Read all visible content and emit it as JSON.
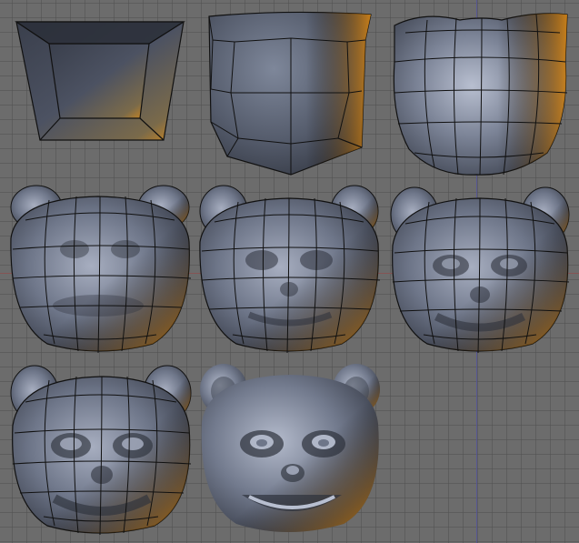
{
  "viewport": {
    "grid_color": "#505050",
    "background_color": "#6c6c6c",
    "axis_x_color": "#8a5050",
    "axis_y_color": "#55559a"
  },
  "material": {
    "base_color": "#8a93a8",
    "shadow_color": "#30343f",
    "highlight_color": "#c9cfdd",
    "rim_light_color": "#d48a1c",
    "wire_color": "#111111"
  },
  "stages": [
    {
      "id": "stage-1",
      "shape": "box",
      "wireframe": true
    },
    {
      "id": "stage-2",
      "shape": "shield",
      "wireframe": true
    },
    {
      "id": "stage-3",
      "shape": "rounded-head",
      "wireframe": true
    },
    {
      "id": "stage-4",
      "shape": "bear-head",
      "wireframe": true,
      "detail": 1
    },
    {
      "id": "stage-5",
      "shape": "bear-head",
      "wireframe": true,
      "detail": 2
    },
    {
      "id": "stage-6",
      "shape": "bear-head",
      "wireframe": true,
      "detail": 3
    },
    {
      "id": "stage-7",
      "shape": "bear-head",
      "wireframe": true,
      "detail": 4
    },
    {
      "id": "stage-8",
      "shape": "bear-head",
      "wireframe": false,
      "detail": 5
    }
  ]
}
